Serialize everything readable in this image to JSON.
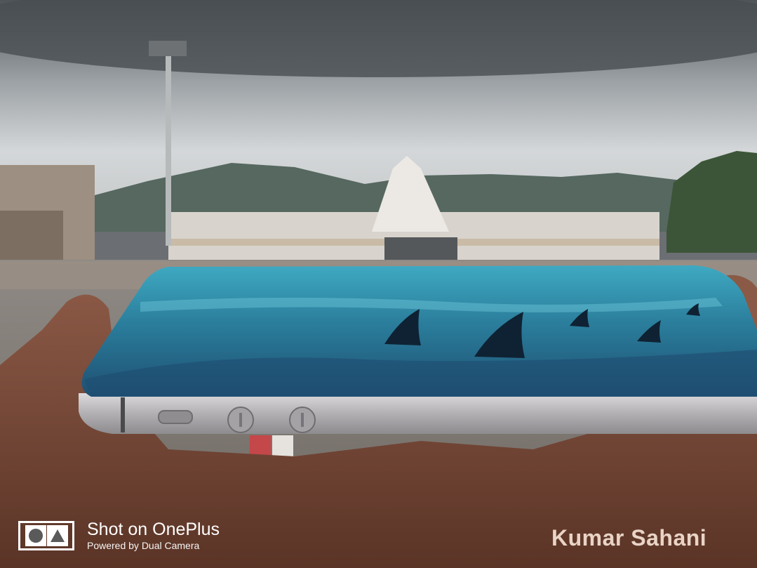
{
  "watermark": {
    "logo_icon": "oneplus-dual-camera-logo-icon",
    "title": "Shot on OnePlus",
    "subtitle": "Powered by Dual Camera"
  },
  "credit": {
    "name": "Kumar Sahani"
  },
  "colors": {
    "sky": "#c9cdd0",
    "storm_cloud": "#4f5559",
    "sea": "#2f7f99",
    "phone_frame": "#b5b3b6",
    "skin": "#7a4b38",
    "credit_text": "#e9d4c6"
  }
}
